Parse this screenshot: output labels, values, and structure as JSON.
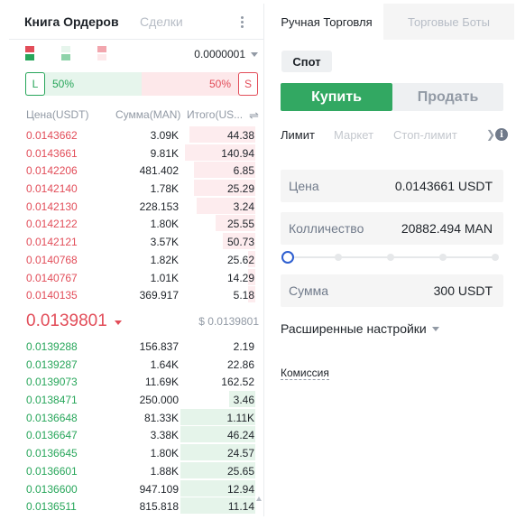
{
  "orderbook": {
    "tab_active": "Книга Ордеров",
    "tab_inactive": "Сделки",
    "precision": "0.0000001",
    "ratio": {
      "buy_label": "L",
      "sell_label": "S",
      "buy_pct": "50%",
      "sell_pct": "50%",
      "buy_fraction": 0.5
    },
    "columns": {
      "price": "Цена(USDT)",
      "amount": "Сумма(MAN)",
      "total": "Итого(US..."
    },
    "asks": [
      {
        "price": "0.0143662",
        "amount": "3.09K",
        "total": "44.38",
        "depth": 0.28
      },
      {
        "price": "0.0143661",
        "amount": "9.81K",
        "total": "140.94",
        "depth": 0.3
      },
      {
        "price": "0.0142206",
        "amount": "481.402",
        "total": "6.85",
        "depth": 0.26
      },
      {
        "price": "0.0142140",
        "amount": "1.78K",
        "total": "25.29",
        "depth": 0.26
      },
      {
        "price": "0.0142130",
        "amount": "228.153",
        "total": "3.24",
        "depth": 0.25
      },
      {
        "price": "0.0142122",
        "amount": "1.80K",
        "total": "25.55",
        "depth": 0.17
      },
      {
        "price": "0.0142121",
        "amount": "3.57K",
        "total": "50.73",
        "depth": 0.14
      },
      {
        "price": "0.0140768",
        "amount": "1.82K",
        "total": "25.62",
        "depth": 0.03
      },
      {
        "price": "0.0140767",
        "amount": "1.01K",
        "total": "14.29",
        "depth": 0.03
      },
      {
        "price": "0.0140135",
        "amount": "369.917",
        "total": "5.18",
        "depth": 0.03
      }
    ],
    "last_price": "0.0139801",
    "mark_price": "$ 0.0139801",
    "bids": [
      {
        "price": "0.0139288",
        "amount": "156.837",
        "total": "2.19",
        "depth": 0.0
      },
      {
        "price": "0.0139287",
        "amount": "1.64K",
        "total": "22.86",
        "depth": 0.0
      },
      {
        "price": "0.0139073",
        "amount": "11.69K",
        "total": "162.52",
        "depth": 0.0
      },
      {
        "price": "0.0138471",
        "amount": "250.000",
        "total": "3.46",
        "depth": 0.11
      },
      {
        "price": "0.0136648",
        "amount": "81.33K",
        "total": "1.11K",
        "depth": 0.32
      },
      {
        "price": "0.0136647",
        "amount": "3.38K",
        "total": "46.24",
        "depth": 0.32
      },
      {
        "price": "0.0136645",
        "amount": "1.80K",
        "total": "24.57",
        "depth": 0.32
      },
      {
        "price": "0.0136601",
        "amount": "1.88K",
        "total": "25.65",
        "depth": 0.32
      },
      {
        "price": "0.0136600",
        "amount": "947.109",
        "total": "12.94",
        "depth": 0.32
      },
      {
        "price": "0.0136511",
        "amount": "815.818",
        "total": "11.14",
        "depth": 0.32
      }
    ]
  },
  "trade": {
    "tab_active": "Ручная Торговля",
    "tab_inactive": "Торговые Боты",
    "spot_label": "Спот",
    "buy_label": "Купить",
    "sell_label": "Продать",
    "order_types": [
      "Лимит",
      "Маркет",
      "Стоп-лимит"
    ],
    "price": {
      "label": "Цена",
      "value": "0.0143661 USDT"
    },
    "quantity": {
      "label": "Колличество",
      "value": "20882.494 MAN"
    },
    "slider_fraction": 0,
    "sum": {
      "label": "Сумма",
      "value": "300 USDT"
    },
    "advanced_label": "Расширенные настройки",
    "fee_label": "Комиссия"
  },
  "colors": {
    "buy": "#27a65a",
    "sell": "#e24d59",
    "buy_button": "#32a862",
    "slider": "#2f5fd0"
  },
  "icons": [
    "more-vertical-icon",
    "view-both-icon",
    "view-bids-icon",
    "view-asks-icon",
    "caret-down-icon",
    "swap-icon",
    "chevron-right-icon",
    "info-icon"
  ]
}
